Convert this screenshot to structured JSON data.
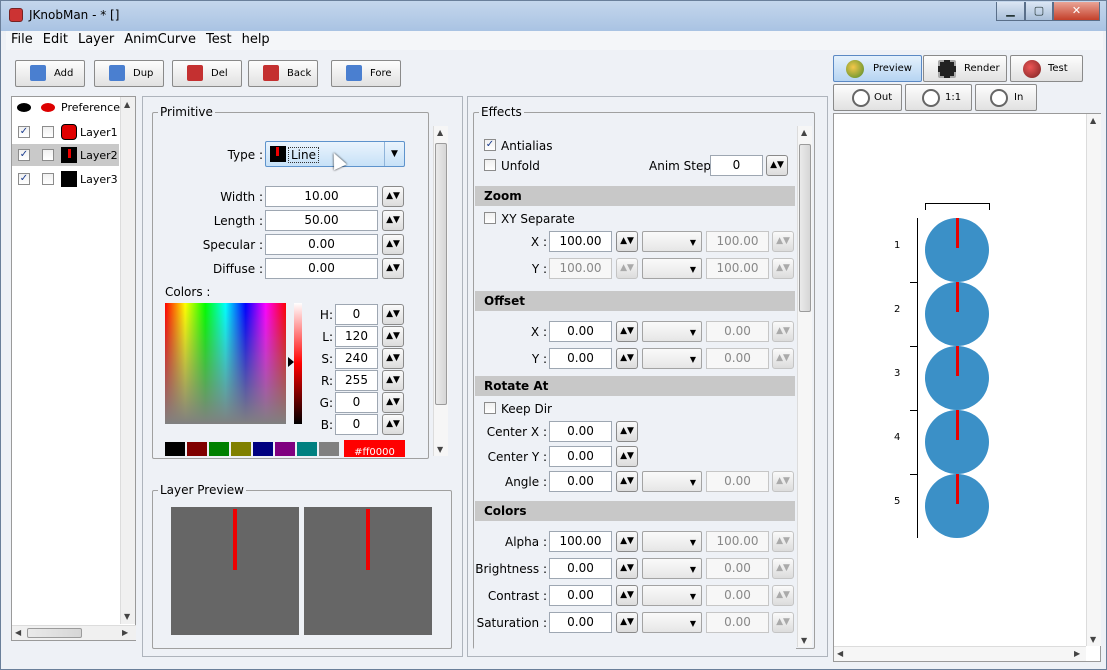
{
  "window": {
    "title": "JKnobMan - * []"
  },
  "menu": [
    "File",
    "Edit",
    "Layer",
    "AnimCurve",
    "Test",
    "help"
  ],
  "toolbar": [
    {
      "label": "Add",
      "icon": "add-star-icon",
      "color": "#3a6fc6"
    },
    {
      "label": "Dup",
      "icon": "duplicate-icon",
      "color": "#3a6fc6"
    },
    {
      "label": "Del",
      "icon": "delete-icon",
      "color": "#c43030"
    },
    {
      "label": "Back",
      "icon": "back-icon",
      "color": "#c43030"
    },
    {
      "label": "Fore",
      "icon": "fore-icon",
      "color": "#3a6fc6"
    }
  ],
  "layers": {
    "preference": "Preference",
    "items": [
      {
        "name": "Layer1",
        "visible": true,
        "solo": false,
        "color": "#e00000"
      },
      {
        "name": "Layer2",
        "visible": true,
        "solo": false,
        "color": "#e00000",
        "selected": true
      },
      {
        "name": "Layer3",
        "visible": true,
        "solo": false,
        "color": "#000000"
      }
    ]
  },
  "primitive": {
    "title": "Primitive",
    "type_label": "Type :",
    "type_value": "Line",
    "fields": [
      {
        "label": "Width :",
        "value": "10.00"
      },
      {
        "label": "Length :",
        "value": "50.00"
      },
      {
        "label": "Specular :",
        "value": "0.00"
      },
      {
        "label": "Diffuse :",
        "value": "0.00"
      }
    ],
    "colors_label": "Colors :",
    "hsl": [
      {
        "label": "H:",
        "value": "0"
      },
      {
        "label": "L:",
        "value": "120"
      },
      {
        "label": "S:",
        "value": "240"
      },
      {
        "label": "R:",
        "value": "255"
      },
      {
        "label": "G:",
        "value": "0"
      },
      {
        "label": "B:",
        "value": "0"
      }
    ],
    "palette": [
      "#000000",
      "#800000",
      "#008000",
      "#808000",
      "#000080",
      "#800080",
      "#008080",
      "#808080"
    ],
    "hex": "#ff0000"
  },
  "layer_preview": {
    "title": "Layer Preview"
  },
  "effects": {
    "title": "Effects",
    "antialias": "Antialias",
    "unfold": "Unfold",
    "anim_step_label": "Anim Step:",
    "anim_step": "0",
    "zoom": {
      "title": "Zoom",
      "xy_separate": "XY Separate",
      "x_label": "X :",
      "x": "100.00",
      "x2": "100.00",
      "y_label": "Y :",
      "y": "100.00",
      "y2": "100.00"
    },
    "offset": {
      "title": "Offset",
      "x_label": "X :",
      "x": "0.00",
      "x2": "0.00",
      "y_label": "Y :",
      "y": "0.00",
      "y2": "0.00"
    },
    "rotate": {
      "title": "Rotate At",
      "keep_dir": "Keep Dir",
      "cx_label": "Center X :",
      "cx": "0.00",
      "cy_label": "Center Y :",
      "cy": "0.00",
      "angle_label": "Angle :",
      "angle": "0.00",
      "angle2": "0.00"
    },
    "colors": {
      "title": "Colors",
      "rows": [
        {
          "label": "Alpha :",
          "value": "100.00",
          "value2": "100.00"
        },
        {
          "label": "Brightness :",
          "value": "0.00",
          "value2": "0.00"
        },
        {
          "label": "Contrast :",
          "value": "0.00",
          "value2": "0.00"
        },
        {
          "label": "Saturation :",
          "value": "0.00",
          "value2": "0.00"
        }
      ]
    }
  },
  "preview": {
    "buttons": [
      {
        "label": "Preview",
        "icon": "preview-icon"
      },
      {
        "label": "Render",
        "icon": "render-icon"
      },
      {
        "label": "Test",
        "icon": "test-icon"
      },
      {
        "label": "Out",
        "icon": "zoom-out-icon"
      },
      {
        "label": "1:1",
        "icon": "zoom-actual-icon"
      },
      {
        "label": "In",
        "icon": "zoom-in-icon"
      }
    ],
    "frames": [
      "1",
      "2",
      "3",
      "4",
      "5"
    ],
    "knob_color": "#3b90c7",
    "pointer_color": "#e60000"
  }
}
